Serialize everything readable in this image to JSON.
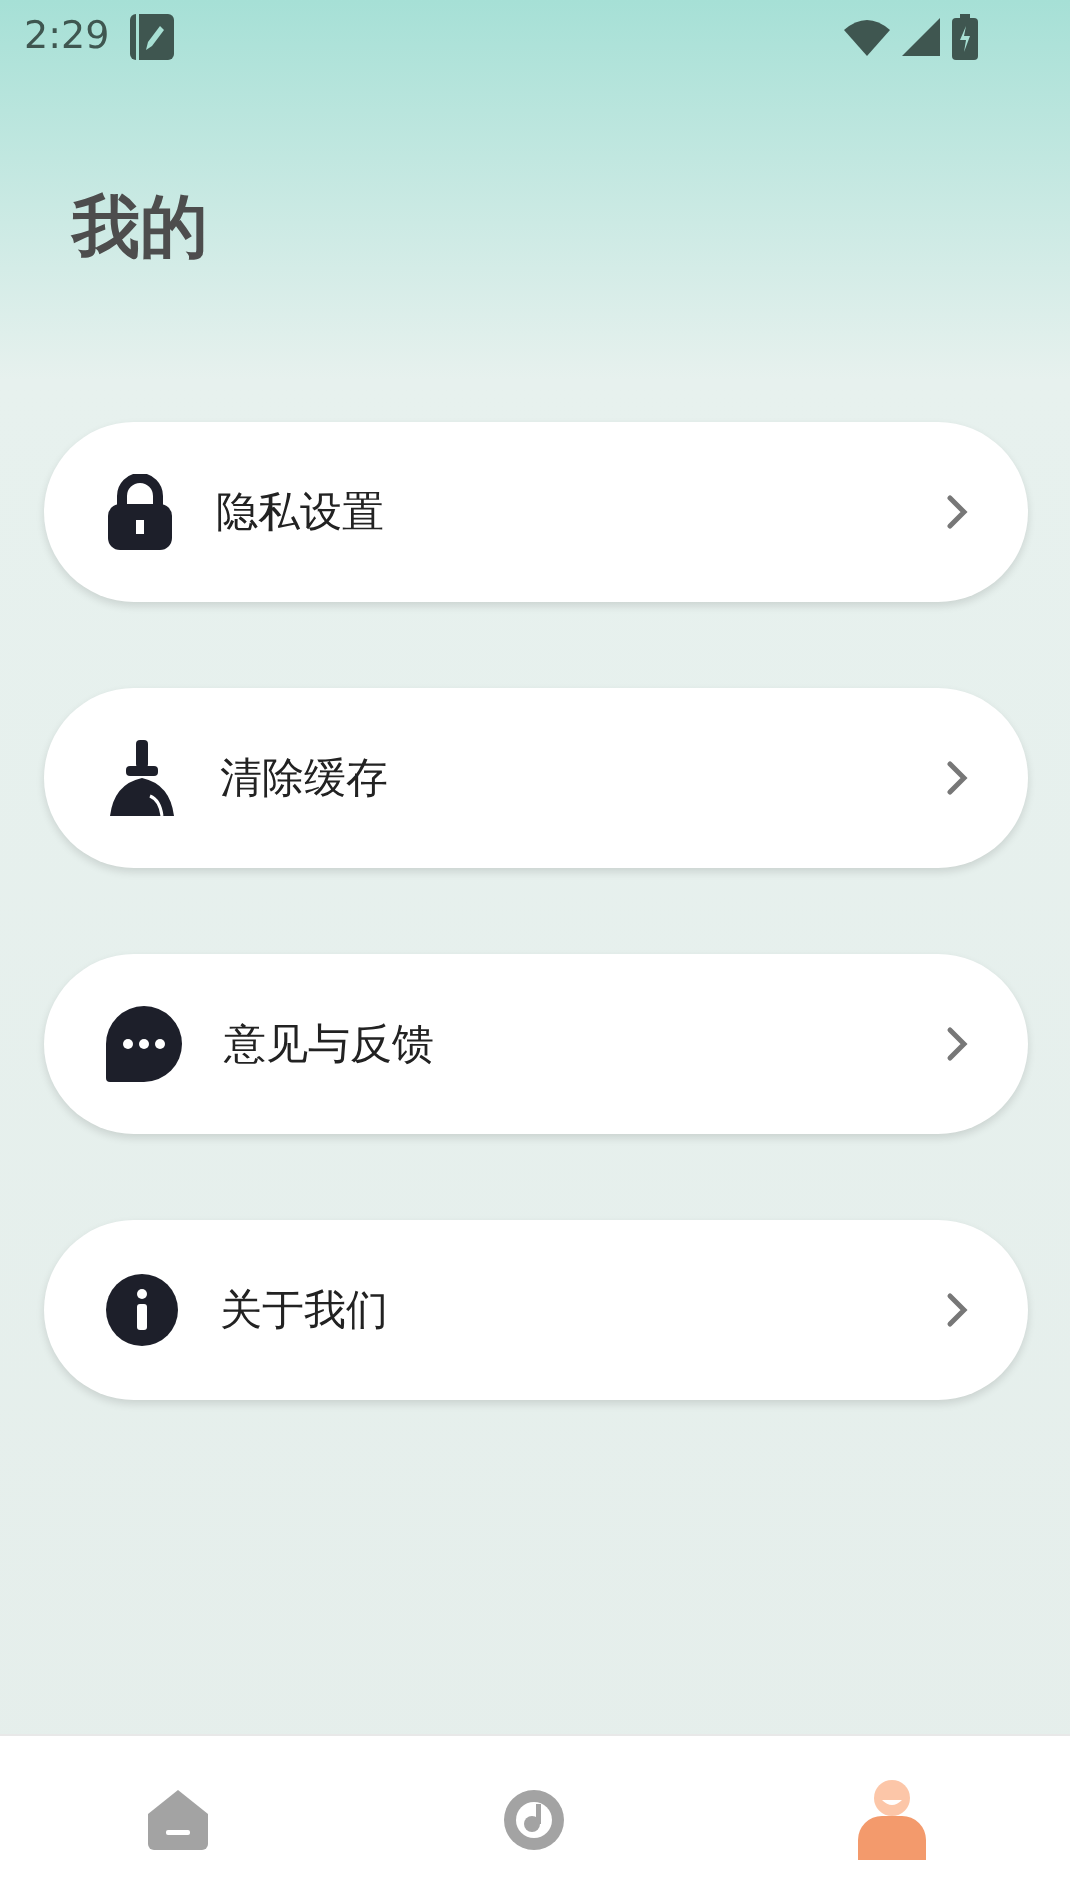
{
  "status_bar": {
    "time": "2:29"
  },
  "title": "我的",
  "menu": [
    {
      "kind": "lock",
      "label": "隐私设置"
    },
    {
      "kind": "broom",
      "label": "清除缓存"
    },
    {
      "kind": "chat",
      "label": "意见与反馈"
    },
    {
      "kind": "info",
      "label": "关于我们"
    }
  ],
  "nav": [
    {
      "kind": "home",
      "selected": false
    },
    {
      "kind": "music",
      "selected": false
    },
    {
      "kind": "person",
      "selected": true
    }
  ]
}
